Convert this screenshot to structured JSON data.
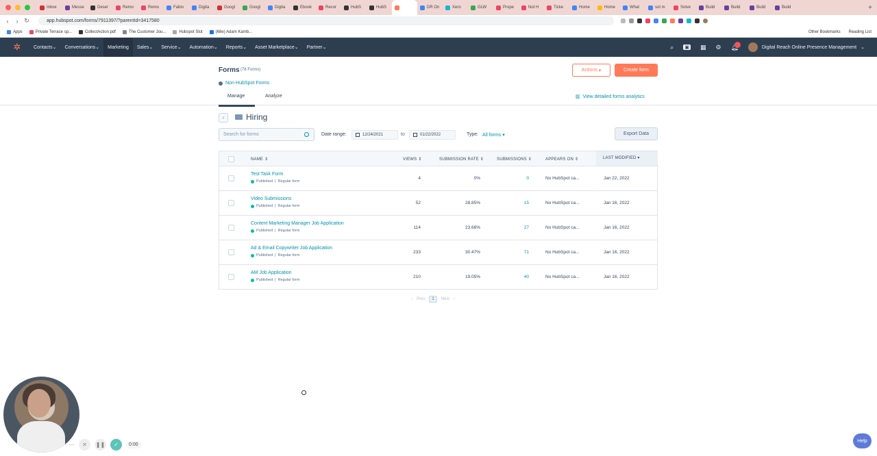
{
  "browser": {
    "tabs": [
      "Inbox",
      "Messe",
      "Deser",
      "Remo",
      "Remo",
      "Fabio",
      "Digita",
      "Googl",
      "Googl",
      "Digita",
      "Ebook",
      "Recor",
      "HubS",
      "HubS",
      "",
      "DR On",
      "Xero",
      "GLW",
      "Prope",
      "Not H",
      "Ticke",
      "Home",
      "Home",
      "What",
      "sot m",
      "Solve",
      "Build",
      "Build",
      "Build",
      "Build"
    ],
    "tab_colors": [
      "#c33",
      "#6b3fa0",
      "#333",
      "#e46",
      "#e46",
      "#4285f4",
      "#4285f4",
      "#c33",
      "#34a853",
      "#4285f4",
      "#333",
      "#e46",
      "#333",
      "#333",
      "#ff7a59",
      "#4285f4",
      "#1ab4d7",
      "#34a853",
      "#e46",
      "#e46",
      "#e46",
      "#4285f4",
      "#fbbc05",
      "#4285f4",
      "#4285f4",
      "#e46",
      "#6b3fa0",
      "#6b3fa0",
      "#6b3fa0",
      "#6b3fa0"
    ],
    "active_tab_index": 14,
    "url": "app.hubspot.com/forms/7911397/?parentId=3417580",
    "bookmarks": [
      "Apps",
      "Private Terrace sp...",
      "CollectAction.pdf",
      "The Customer Jou...",
      "Hubspot Slut",
      "(68e) Adam Kamb..."
    ],
    "bookmarks_right": [
      "Other Bookmarks",
      "Reading List"
    ]
  },
  "nav": {
    "items": [
      "Contacts",
      "Conversations",
      "Marketing",
      "Sales",
      "Service",
      "Automation",
      "Reports",
      "Asset Marketplace",
      "Partner"
    ],
    "active_index": 2,
    "notification_count": "10",
    "account_name": "Digital Reach Online Presence Management"
  },
  "page": {
    "title": "Forms",
    "count": "(76 Forms)",
    "actions_label": "Actions",
    "create_label": "Create form",
    "non_hubspot_label": "Non-HubSpot Forms",
    "tabs": [
      "Manage",
      "Analyze"
    ],
    "view_analytics_label": "View detailed forms analytics",
    "folder_title": "Hiring",
    "search_placeholder": "Search for forms",
    "date_range_label": "Date range:",
    "date_from": "12/24/2021",
    "date_to_sep": "to",
    "date_to": "01/22/2022",
    "type_label": "Type:",
    "type_value": "All forms",
    "export_label": "Export Data"
  },
  "table": {
    "headers": [
      "NAME",
      "VIEWS",
      "SUBMISSION RATE",
      "SUBMISSIONS",
      "APPEARS ON",
      "LAST MODIFIED"
    ],
    "rows": [
      {
        "name": "Test Task Form",
        "status": "Published",
        "kind": "Regular form",
        "views": "4",
        "rate": "0%",
        "submissions": "0",
        "appears": "No HubSpot ca...",
        "modified": "Jan 22, 2022"
      },
      {
        "name": "Video Submissions",
        "status": "Published",
        "kind": "Regular form",
        "views": "52",
        "rate": "28.85%",
        "submissions": "15",
        "appears": "No HubSpot ca...",
        "modified": "Jan 16, 2022"
      },
      {
        "name": "Content Marketing Manager Job Application",
        "status": "Published",
        "kind": "Regular form",
        "views": "114",
        "rate": "23.68%",
        "submissions": "27",
        "appears": "No HubSpot ca...",
        "modified": "Jan 16, 2022"
      },
      {
        "name": "Ad & Email Copywriter Job Application",
        "status": "Published",
        "kind": "Regular form",
        "views": "233",
        "rate": "30.47%",
        "submissions": "71",
        "appears": "No HubSpot ca...",
        "modified": "Jan 16, 2022"
      },
      {
        "name": "AM Job Application",
        "status": "Published",
        "kind": "Regular form",
        "views": "210",
        "rate": "19.05%",
        "submissions": "40",
        "appears": "No HubSpot ca...",
        "modified": "Jan 16, 2022"
      }
    ]
  },
  "pager": {
    "prev": "Prev",
    "page": "1",
    "next": "Next"
  },
  "recorder": {
    "time": "0:00"
  },
  "help_label": "Help"
}
